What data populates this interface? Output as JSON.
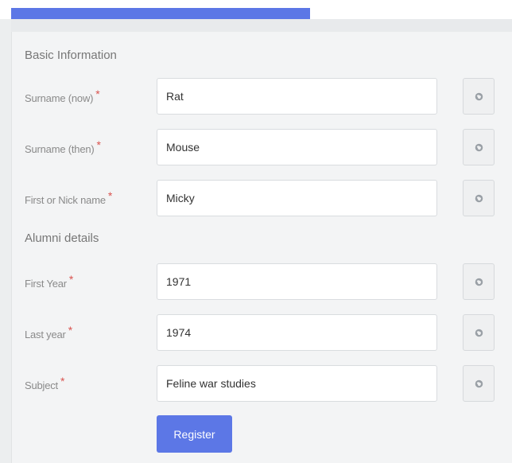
{
  "sections": {
    "basic_title": "Basic Information",
    "alumni_title": "Alumni details"
  },
  "required_mark": "*",
  "fields": [
    {
      "label": "Surname (now)",
      "value": "Rat",
      "icon": "globe-icon"
    },
    {
      "label": "Surname (then)",
      "value": "Mouse",
      "icon": "globe-icon"
    },
    {
      "label": "First or Nick name",
      "value": "Micky",
      "icon": "globe-icon"
    },
    {
      "label": "First Year",
      "value": "1971",
      "icon": "globe-icon"
    },
    {
      "label": "Last year",
      "value": "1974",
      "icon": "globe-icon"
    },
    {
      "label": "Subject",
      "value": "Feline war studies",
      "icon": "globe-icon"
    }
  ],
  "register_label": "Register",
  "colors": {
    "accent": "#5c77e6",
    "required": "#d9534f",
    "panel_bg": "#f3f4f5"
  }
}
